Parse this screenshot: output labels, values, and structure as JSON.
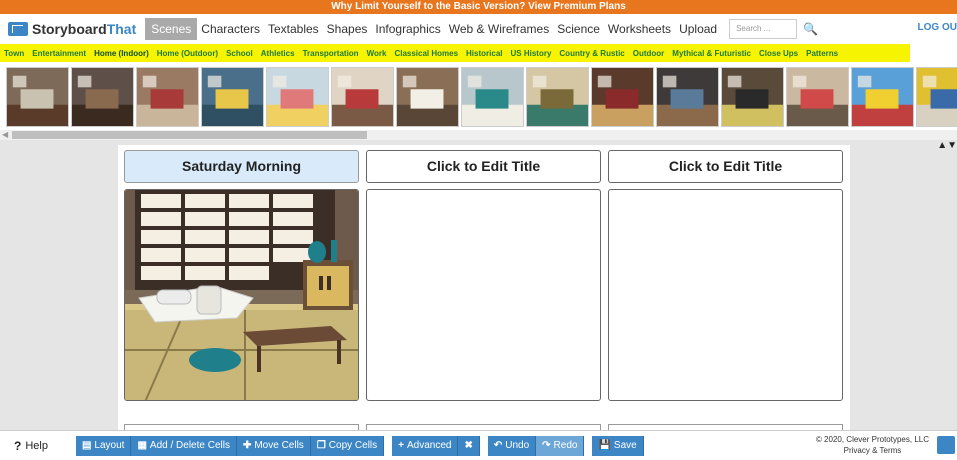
{
  "promo": {
    "text": "Why Limit Yourself to the Basic Version?   View Premium Plans"
  },
  "nav": {
    "logo_part1": "Storyboard",
    "logo_part2": "That",
    "links": [
      "Scenes",
      "Characters",
      "Textables",
      "Shapes",
      "Infographics",
      "Web & Wireframes",
      "Science",
      "Worksheets",
      "Upload"
    ],
    "search_placeholder": "Search ...",
    "logout": "LOG OU"
  },
  "categories": [
    "Town",
    "Entertainment",
    "Home (Indoor)",
    "Home (Outdoor)",
    "School",
    "Athletics",
    "Transportation",
    "Work",
    "Classical Homes",
    "Historical",
    "US History",
    "Country & Rustic",
    "Outdoor",
    "Mythical & Futuristic",
    "Close Ups",
    "Patterns"
  ],
  "selected_category": "Home (Indoor)",
  "thumbnails": [
    "entry-hall",
    "front-door",
    "staircase",
    "living-room-yellow",
    "bedroom-bunting",
    "bedroom-red",
    "bedroom-wood",
    "bedroom-teal",
    "kitchen-dining",
    "library",
    "dark-bedroom",
    "living-room-tv",
    "office-room",
    "bunk-bedroom",
    "patterned-room",
    "extra-room"
  ],
  "board": {
    "titles": [
      "Saturday Morning",
      "Click to Edit Title",
      "Click to Edit Title"
    ]
  },
  "toolbar": {
    "help": "Help",
    "layout": "Layout",
    "add_delete": "Add / Delete Cells",
    "move": "Move Cells",
    "copy": "Copy Cells",
    "advanced": "Advanced",
    "undo": "Undo",
    "redo": "Redo",
    "save": "Save"
  },
  "footer": {
    "copyright": "© 2020, Clever Prototypes, LLC",
    "privacy": "Privacy & Terms"
  },
  "colors": {
    "accent": "#3d86c6",
    "promo": "#e8761f",
    "category_bar": "#f6f400"
  }
}
